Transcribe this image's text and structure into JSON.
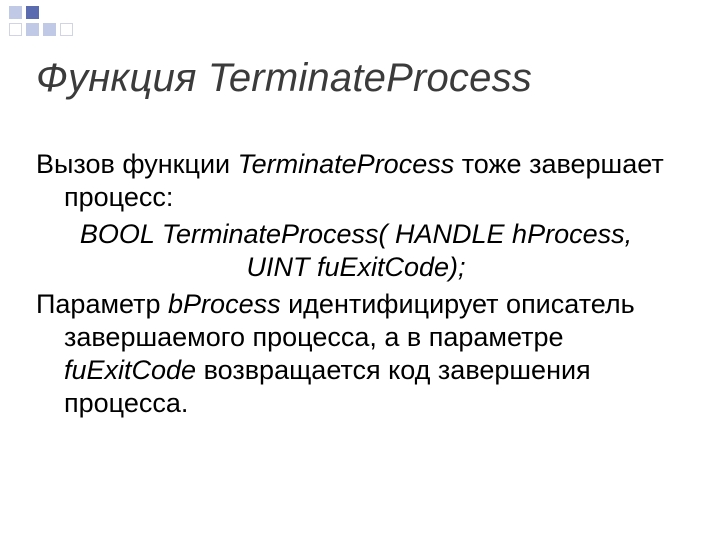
{
  "title": "Функция TerminateProcess",
  "intro_pre": "Вызов функции ",
  "intro_fn": "TerminateProcess",
  "intro_post": " тоже завершает процесс:",
  "signature": "BOOL TerminateProcess( HANDLE hProcess, UINT fuExitCode",
  "signature_tail": ");",
  "desc_1": "Параметр ",
  "desc_param1": "bProcess",
  "desc_2": " идентифицирует описатель завершаемого процесса, а в параметре ",
  "desc_param2": "fuExitCode",
  "desc_3": " возвращается код завершения процесса."
}
